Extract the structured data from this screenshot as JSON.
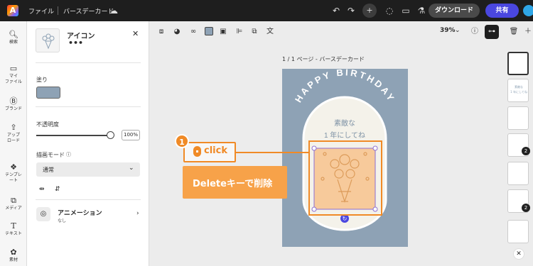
{
  "app": {
    "menu_label": "ファイル",
    "doc_title": "バースデーカード"
  },
  "topbar": {
    "download_label": "ダウンロード",
    "share_label": "共有"
  },
  "rail": [
    {
      "label": "検索"
    },
    {
      "label": "マイ\nファイル"
    },
    {
      "label": "ブランド"
    },
    {
      "label": "アップ\nロード"
    },
    {
      "label": "テンプレ\nート"
    },
    {
      "label": "メディア"
    },
    {
      "label": "テキスト"
    },
    {
      "label": "素材"
    }
  ],
  "panel": {
    "title": "アイコン",
    "more": "•••",
    "fill_label": "塗り",
    "fill_color": "#8ea2b5",
    "opacity_label": "不透明度",
    "opacity_value": "100%",
    "blend_label": "描画モード",
    "blend_value": "通常",
    "animation_title": "アニメーション",
    "animation_sub": "なし"
  },
  "toolbar": {
    "zoom": "39%"
  },
  "canvas": {
    "page_label": "1 / 1 ページ - バースデーカード",
    "card": {
      "headline": "HAPPY BIRTHDAY",
      "message_line1": "素敵な",
      "message_line2": "1 年にしてね",
      "background_color": "#8ea2b5"
    }
  },
  "pages": [
    {
      "badge": ""
    },
    {
      "badge": "",
      "line1": "素敵な",
      "line2": "1 年にしてね"
    },
    {
      "badge": ""
    },
    {
      "badge": "2"
    },
    {
      "badge": ""
    },
    {
      "badge": "2"
    },
    {
      "badge": ""
    }
  ],
  "annotation": {
    "step_number": "1",
    "click_label": "click",
    "instruction": "Deleteキーで削除",
    "accent_color": "#f08a26"
  }
}
